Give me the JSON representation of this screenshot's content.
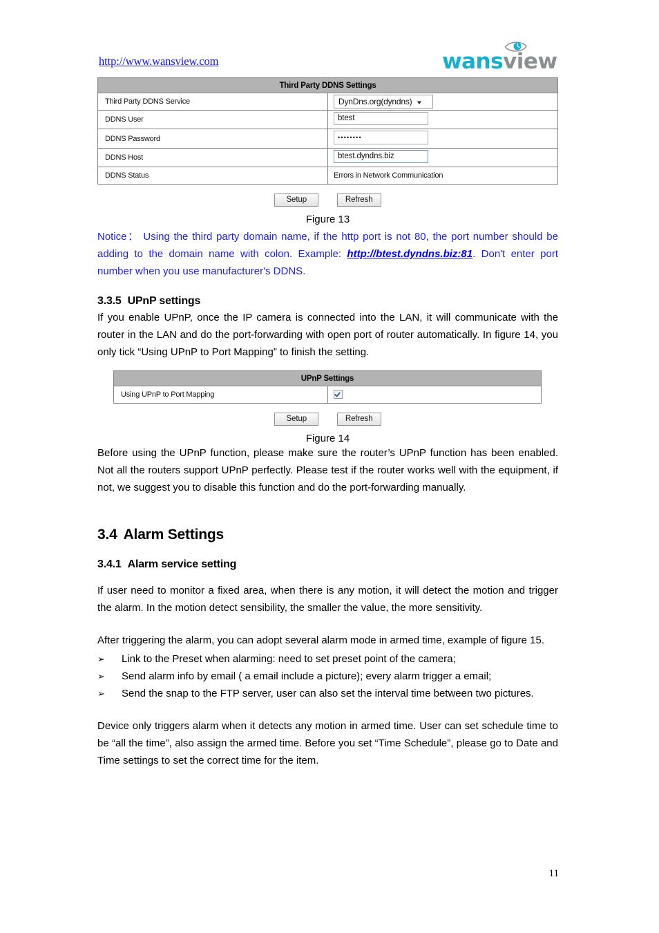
{
  "header": {
    "site_url": "http://www.wansview.com",
    "logo": {
      "brand_first": "wans",
      "brand_second": "view",
      "brand_first_color": "#16b0cf",
      "brand_second_color": "#8a8f92",
      "eye_icon": "eye-icon"
    }
  },
  "ddns_panel": {
    "title": "Third Party DDNS Settings",
    "rows": [
      {
        "label": "Third Party DDNS Service",
        "value": "DynDns.org(dyndns)",
        "control": "select"
      },
      {
        "label": "DDNS User",
        "value": "btest",
        "control": "text"
      },
      {
        "label": "DDNS Password",
        "value": "••••••••",
        "control": "password"
      },
      {
        "label": "DDNS Host",
        "value": "btest.dyndns.biz",
        "control": "text-focused"
      },
      {
        "label": "DDNS Status",
        "value": "Errors in Network Communication",
        "control": "static"
      }
    ],
    "buttons": {
      "setup": "Setup",
      "refresh": "Refresh"
    },
    "caption": "Figure 13"
  },
  "notice": {
    "lead": "Notice：",
    "body_before_link": " Using the third party domain name, if the http port is not 80, the port number should be adding to the domain name with colon. Example: ",
    "link": "http://btest.dyndns.biz:81",
    "body_after_link": ". Don't enter port number when you use manufacturer's DDNS.",
    "color": "#1f1fd8"
  },
  "section_upnp": {
    "number": "3.3.5",
    "title": "UPnP settings",
    "paragraph": "If you enable UPnP, once the IP camera is connected into the LAN, it will communicate with the router in the LAN and do the port-forwarding with open port of router automatically. In figure 14, you only tick “Using UPnP to Port Mapping” to finish the setting."
  },
  "upnp_panel": {
    "title": "UPnP Settings",
    "rows": [
      {
        "label": "Using UPnP to Port Mapping",
        "value": "checked",
        "control": "checkbox"
      }
    ],
    "buttons": {
      "setup": "Setup",
      "refresh": "Refresh"
    },
    "caption": "Figure 14"
  },
  "upnp_after_paragraph": "Before using the UPnP function, please make sure the router’s UPnP function has been enabled. Not all the routers support UPnP perfectly. Please test if the router works well with the equipment, if not, we suggest you to disable this function and do the port-forwarding manually.",
  "section_alarm": {
    "number": "3.4",
    "title": "Alarm Settings"
  },
  "section_alarm_service": {
    "number": "3.4.1",
    "title": "Alarm service setting",
    "paragraph_1": "If user need to monitor a fixed area, when there is any motion, it will detect the motion and trigger the alarm. In the motion detect sensibility, the smaller the value, the more sensitivity.",
    "paragraph_2": "After triggering the alarm, you can adopt several alarm mode in armed time, example of figure 15.",
    "bullet_marker": "➢",
    "bullets": [
      "Link to the Preset when alarming: need to set preset point of the camera;",
      "Send alarm info by email ( a email include a picture); every alarm trigger a email;",
      "Send the snap to the FTP server, user can also set the interval time between two pictures."
    ],
    "paragraph_3": "Device only triggers alarm when it detects any motion in armed time. User can set schedule time to be “all the time”, also assign the armed time. Before you set “Time Schedule”, please go to Date and Time settings to set the correct time for the item."
  },
  "footer": {
    "page_number": "11"
  }
}
